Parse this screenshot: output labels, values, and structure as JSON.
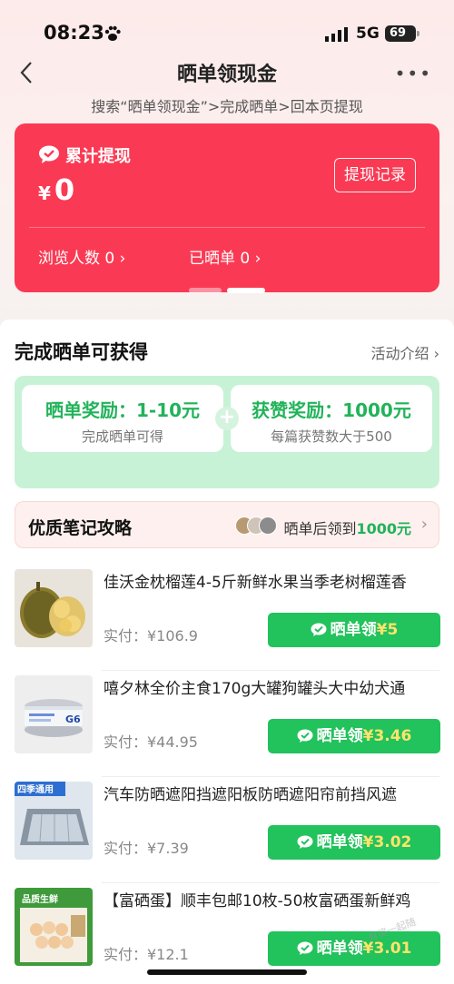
{
  "status_bar": {
    "time": "08:23",
    "network": "5G",
    "battery": "69"
  },
  "nav": {
    "title": "晒单领现金"
  },
  "steps": "搜索“晒单领现金”>完成晒单>回本页提现",
  "summary_card": {
    "label": "累计提现",
    "currency": "¥",
    "amount": "0",
    "record_button": "提现记录",
    "views": "浏览人数 0",
    "shared": "已晒单 0"
  },
  "rewards": {
    "title": "完成晒单可获得",
    "intro_link": "活动介绍",
    "share_reward": {
      "title": "晒单奖励：1-10元",
      "sub": "完成晒单可得"
    },
    "like_reward": {
      "title": "获赞奖励：1000元",
      "sub": "每篇获赞数大于500"
    }
  },
  "strategy": {
    "title": "优质笔记攻略",
    "text_prefix": "晒单后领到",
    "text_amount": "1000元"
  },
  "products": [
    {
      "name": "佳沃金枕榴莲4-5斤新鲜水果当季老树榴莲香",
      "price": "实付：¥106.9",
      "button": "晒单领",
      "reward": "¥5"
    },
    {
      "name": "嘻夕林全价主食170g大罐狗罐头大中幼犬通",
      "price": "实付：¥44.95",
      "button": "晒单领",
      "reward": "¥3.46"
    },
    {
      "name": "汽车防晒遮阳挡遮阳板防晒遮阳帘前挡风遮",
      "price": "实付：¥7.39",
      "button": "晒单领",
      "reward": "¥3.02"
    },
    {
      "name": "【富硒蛋】顺丰包邮10枚-50枚富硒蛋新鲜鸡",
      "price": "实付：¥12.1",
      "button": "晒单领",
      "reward": "¥3.01"
    }
  ],
  "thumb_labels": {
    "can": "G6",
    "sunshade": "四季通用",
    "eggs": "品质生鲜"
  },
  "watermark": "有奖一起随",
  "colors": {
    "red_card": "#fa3a54",
    "green": "#22c25c",
    "reward_yellow": "#ffe36b"
  }
}
